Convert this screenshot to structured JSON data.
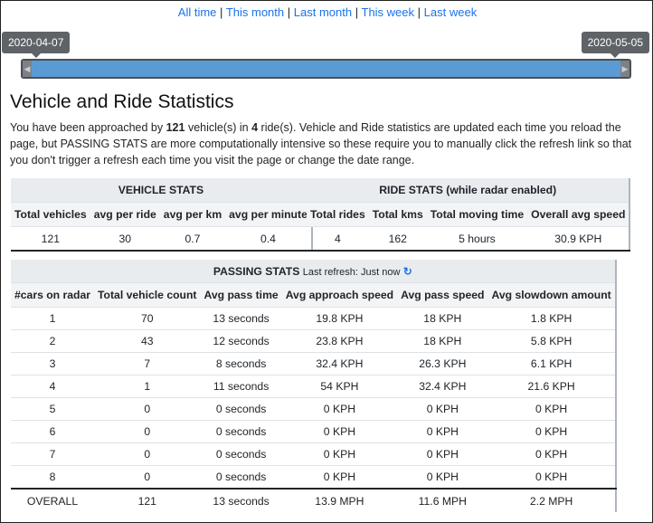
{
  "nav": {
    "links": [
      "All time",
      "This month",
      "Last month",
      "This week",
      "Last week"
    ],
    "separator": "|"
  },
  "slider": {
    "start_label": "2020-04-07",
    "end_label": "2020-05-05",
    "left_handle_icon": "chevron-left-icon",
    "right_handle_icon": "chevron-right-icon"
  },
  "heading": "Vehicle and Ride Statistics",
  "intro": {
    "part1": "You have been approached by ",
    "vehicles": "121",
    "part2": " vehicle(s) in ",
    "rides": "4",
    "part3": " ride(s). Vehicle and Ride statistics are updated each time you reload the page, but PASSING STATS are more computationally intensive so these require you to manually click the refresh link so that you don't trigger a refresh each time you visit the page or change the date range."
  },
  "vehicle_stats": {
    "title": "VEHICLE STATS",
    "headers": [
      "Total vehicles",
      "avg per ride",
      "avg per km",
      "avg per minute"
    ],
    "row": [
      "121",
      "30",
      "0.7",
      "0.4"
    ]
  },
  "ride_stats": {
    "title": "RIDE STATS (while radar enabled)",
    "headers": [
      "Total rides",
      "Total kms",
      "Total moving time",
      "Overall avg speed"
    ],
    "row": [
      "4",
      "162",
      "5 hours",
      "30.9 KPH"
    ]
  },
  "passing_stats": {
    "title": "PASSING STATS",
    "refresh_text": "Last refresh: Just now",
    "refresh_icon": "refresh-icon",
    "headers": [
      "#cars on radar",
      "Total vehicle count",
      "Avg pass time",
      "Avg approach speed",
      "Avg pass speed",
      "Avg slowdown amount"
    ],
    "rows": [
      [
        "1",
        "70",
        "13 seconds",
        "19.8 KPH",
        "18 KPH",
        "1.8 KPH"
      ],
      [
        "2",
        "43",
        "12 seconds",
        "23.8 KPH",
        "18 KPH",
        "5.8 KPH"
      ],
      [
        "3",
        "7",
        "8 seconds",
        "32.4 KPH",
        "26.3 KPH",
        "6.1 KPH"
      ],
      [
        "4",
        "1",
        "11 seconds",
        "54 KPH",
        "32.4 KPH",
        "21.6 KPH"
      ],
      [
        "5",
        "0",
        "0 seconds",
        "0 KPH",
        "0 KPH",
        "0 KPH"
      ],
      [
        "6",
        "0",
        "0 seconds",
        "0 KPH",
        "0 KPH",
        "0 KPH"
      ],
      [
        "7",
        "0",
        "0 seconds",
        "0 KPH",
        "0 KPH",
        "0 KPH"
      ],
      [
        "8",
        "0",
        "0 seconds",
        "0 KPH",
        "0 KPH",
        "0 KPH"
      ]
    ],
    "overall": [
      "OVERALL",
      "121",
      "13 seconds",
      "13.9 MPH",
      "11.6 MPH",
      "2.2 MPH"
    ]
  }
}
